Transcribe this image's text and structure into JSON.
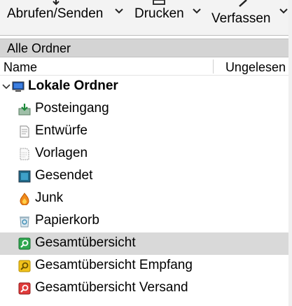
{
  "toolbar": {
    "get_messages_label": "Abrufen/Senden",
    "print_label": "Drucken",
    "compose_label": "Verfassen"
  },
  "folder_pane": {
    "header_title": "Alle Ordner",
    "columns": {
      "name": "Name",
      "unread": "Ungelesen"
    }
  },
  "tree": {
    "account": {
      "label": "Lokale Ordner",
      "icon": "computer-icon",
      "expanded": true
    },
    "folders": [
      {
        "label": "Posteingang",
        "icon": "inbox-icon"
      },
      {
        "label": "Entwürfe",
        "icon": "drafts-icon"
      },
      {
        "label": "Vorlagen",
        "icon": "templates-icon"
      },
      {
        "label": "Gesendet",
        "icon": "sent-icon"
      },
      {
        "label": "Junk",
        "icon": "junk-icon"
      },
      {
        "label": "Papierkorb",
        "icon": "trash-icon"
      },
      {
        "label": "Gesamtübersicht",
        "icon": "saved-search-icon",
        "selected": true
      },
      {
        "label": "Gesamtübersicht Empfang",
        "icon": "saved-search-icon"
      },
      {
        "label": "Gesamtübersicht Versand",
        "icon": "saved-search-icon"
      }
    ]
  },
  "colors": {
    "selection": "#d9d9d9",
    "header_bg": "#d4d4d4",
    "search_green": "#2fa84f",
    "search_yellow": "#f1c21b",
    "search_red": "#e03a3a"
  }
}
